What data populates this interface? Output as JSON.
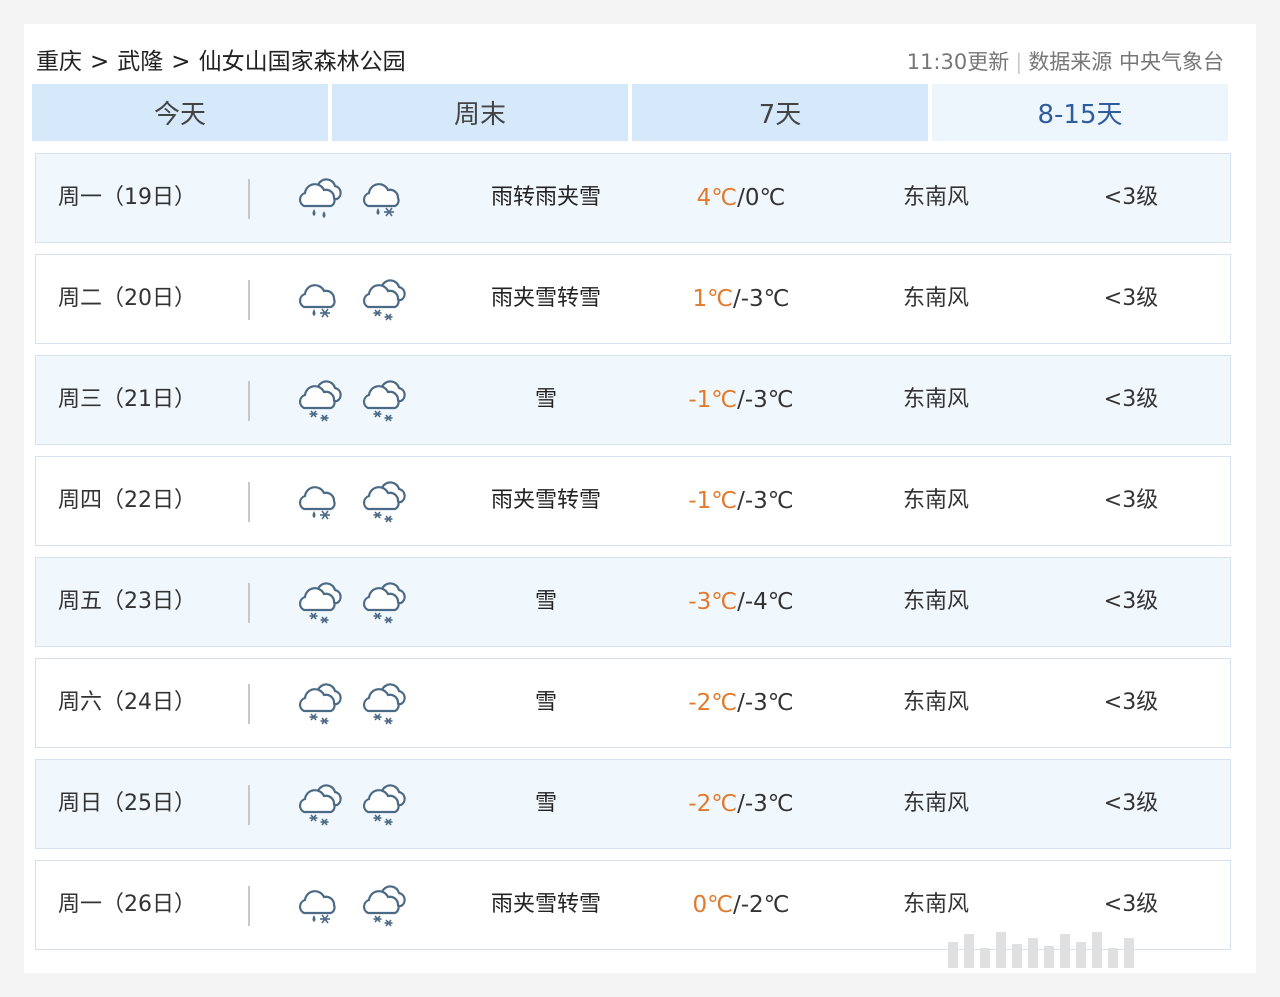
{
  "breadcrumb": {
    "items": [
      "重庆",
      "武隆",
      "仙女山国家森林公园"
    ],
    "separator": ">"
  },
  "meta": {
    "update_time": "11:30更新",
    "source": "数据来源 中央气象台"
  },
  "tabs": [
    {
      "label": "今天",
      "active": false
    },
    {
      "label": "周末",
      "active": false
    },
    {
      "label": "7天",
      "active": false
    },
    {
      "label": "8-15天",
      "active": true
    }
  ],
  "colors": {
    "tab_bg": "#d5e9fa",
    "tab_active_text": "#2f5d9c",
    "high_temp": "#e07a2d",
    "row_alt_bg": "#f1f8fd"
  },
  "forecast": [
    {
      "day": "周一（19日）",
      "icon1": "rain-icon",
      "icon2": "sleet-icon",
      "desc": "雨转雨夹雪",
      "high": "4℃",
      "low": "/0℃",
      "wind": "东南风",
      "level": "<3级"
    },
    {
      "day": "周二（20日）",
      "icon1": "sleet-icon",
      "icon2": "snow-icon",
      "desc": "雨夹雪转雪",
      "high": "1℃",
      "low": "/-3℃",
      "wind": "东南风",
      "level": "<3级"
    },
    {
      "day": "周三（21日）",
      "icon1": "snow-icon",
      "icon2": "snow-icon",
      "desc": "雪",
      "high": "-1℃",
      "low": "/-3℃",
      "wind": "东南风",
      "level": "<3级"
    },
    {
      "day": "周四（22日）",
      "icon1": "sleet-icon",
      "icon2": "snow-icon",
      "desc": "雨夹雪转雪",
      "high": "-1℃",
      "low": "/-3℃",
      "wind": "东南风",
      "level": "<3级"
    },
    {
      "day": "周五（23日）",
      "icon1": "snow-icon",
      "icon2": "snow-icon",
      "desc": "雪",
      "high": "-3℃",
      "low": "/-4℃",
      "wind": "东南风",
      "level": "<3级"
    },
    {
      "day": "周六（24日）",
      "icon1": "snow-icon",
      "icon2": "snow-icon",
      "desc": "雪",
      "high": "-2℃",
      "low": "/-3℃",
      "wind": "东南风",
      "level": "<3级"
    },
    {
      "day": "周日（25日）",
      "icon1": "snow-icon",
      "icon2": "snow-icon",
      "desc": "雪",
      "high": "-2℃",
      "low": "/-3℃",
      "wind": "东南风",
      "level": "<3级"
    },
    {
      "day": "周一（26日）",
      "icon1": "sleet-icon",
      "icon2": "snow-icon",
      "desc": "雨夹雪转雪",
      "high": "0℃",
      "low": "/-2℃",
      "wind": "东南风",
      "level": "<3级"
    }
  ]
}
